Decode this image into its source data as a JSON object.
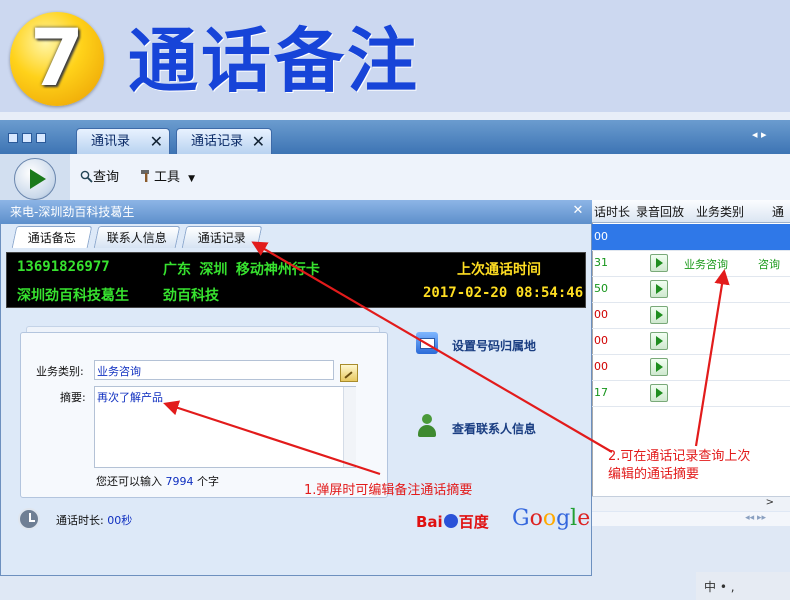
{
  "banner": {
    "step_number": "7",
    "title": "通话备注"
  },
  "app": {
    "tabs": [
      "通讯录",
      "通话记录"
    ],
    "tab_close": "✕",
    "toolbar": {
      "query_label": "查询",
      "tools_label": "工具"
    },
    "scroll_arrows": "◂ ▸"
  },
  "grid": {
    "headers": [
      "话时长",
      "录音回放",
      "业务类别",
      "通"
    ],
    "rows": [
      {
        "duration": "00",
        "type": "",
        "type2": "",
        "selected": true,
        "green": false,
        "play": false
      },
      {
        "duration": "31",
        "type": "业务咨询",
        "type2": "咨询",
        "selected": false,
        "green": true,
        "play": true
      },
      {
        "duration": "50",
        "type": "",
        "type2": "",
        "selected": false,
        "green": true,
        "play": true
      },
      {
        "duration": "00",
        "type": "",
        "type2": "",
        "selected": false,
        "green": false,
        "play": true
      },
      {
        "duration": "00",
        "type": "",
        "type2": "",
        "selected": false,
        "green": false,
        "play": true
      },
      {
        "duration": "00",
        "type": "",
        "type2": "",
        "selected": false,
        "green": false,
        "play": true
      },
      {
        "duration": "17",
        "type": "",
        "type2": "",
        "selected": false,
        "green": true,
        "play": true
      }
    ],
    "hscroll_arrow": ">",
    "hscroll2": "◂◂ ▸▸"
  },
  "tray": "中 • ,",
  "dialog": {
    "title": "来电-深圳劲百科技葛生",
    "close": "✕",
    "tabs": [
      "通话备忘",
      "联系人信息",
      "通话记录"
    ],
    "led": {
      "phone": "13691826977",
      "location": "广东 深圳 移动神州行卡",
      "last_call_label": "上次通话时间",
      "contact": "深圳劲百科技葛生",
      "company": "劲百科技",
      "last_call_time": "2017-02-20 08:54:46"
    },
    "form": {
      "biz_label": "业务类别:",
      "biz_value": "业务咨询",
      "summary_label": "摘要:",
      "summary_value": "再次了解产品",
      "remain_prefix": "您还可以输入",
      "remain_count": "7994",
      "remain_suffix": "个字"
    },
    "actions": {
      "locate": "设置号码归属地",
      "contact": "查看联系人信息"
    },
    "duration_label": "通话时长:",
    "duration_value": "00秒",
    "baidu_left": "Bai",
    "baidu_right": "百度",
    "google_letters": [
      "G",
      "o",
      "o",
      "g",
      "l",
      "e"
    ]
  },
  "colors": {
    "google": [
      "#3366dd",
      "#dd2222",
      "#ffaa00",
      "#3366dd",
      "#22a033",
      "#dd2222"
    ],
    "annotation": "#e21b1b",
    "led_green": "#37e22f",
    "led_yellow": "#ffde22"
  },
  "annotations": {
    "note1": "1.弹屏时可编辑备注通话摘要",
    "note2_line1": "2.可在通话记录查询上次",
    "note2_line2": "编辑的通话摘要"
  }
}
